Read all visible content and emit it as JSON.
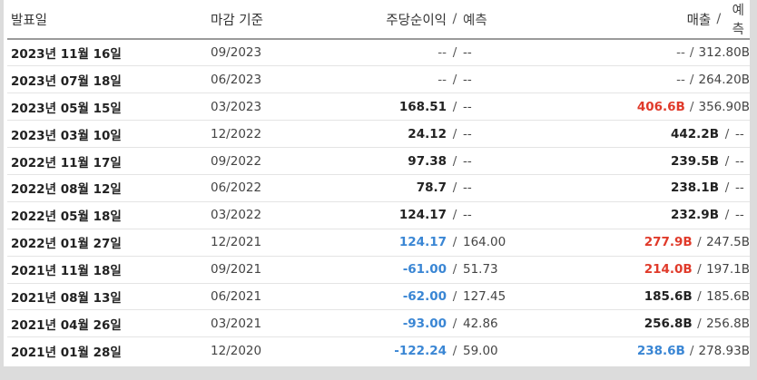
{
  "header": {
    "date": "발표일",
    "period": "마감 기준",
    "eps": "주당순이익",
    "revenue": "매출",
    "separator": "/",
    "forecast": "예측"
  },
  "colors": {
    "beat": "#3a86d4",
    "miss": "#e03a2a",
    "neutral": "#222222"
  },
  "rows": [
    {
      "date": "2023년 11월 16일",
      "period": "09/2023",
      "eps": "--",
      "eps_forecast": "--",
      "eps_status": "dash",
      "revenue": "--",
      "revenue_forecast": "312.80B",
      "revenue_status": "dash"
    },
    {
      "date": "2023년 07월 18일",
      "period": "06/2023",
      "eps": "--",
      "eps_forecast": "--",
      "eps_status": "dash",
      "revenue": "--",
      "revenue_forecast": "264.20B",
      "revenue_status": "dash"
    },
    {
      "date": "2023년 05월 15일",
      "period": "03/2023",
      "eps": "168.51",
      "eps_forecast": "--",
      "eps_status": "neutral",
      "revenue": "406.6B",
      "revenue_forecast": "356.90B",
      "revenue_status": "red"
    },
    {
      "date": "2023년 03월 10일",
      "period": "12/2022",
      "eps": "24.12",
      "eps_forecast": "--",
      "eps_status": "neutral",
      "revenue": "442.2B",
      "revenue_forecast": "--",
      "revenue_status": "neutral"
    },
    {
      "date": "2022년 11월 17일",
      "period": "09/2022",
      "eps": "97.38",
      "eps_forecast": "--",
      "eps_status": "neutral",
      "revenue": "239.5B",
      "revenue_forecast": "--",
      "revenue_status": "neutral"
    },
    {
      "date": "2022년 08월 12일",
      "period": "06/2022",
      "eps": "78.7",
      "eps_forecast": "--",
      "eps_status": "neutral",
      "revenue": "238.1B",
      "revenue_forecast": "--",
      "revenue_status": "neutral"
    },
    {
      "date": "2022년 05월 18일",
      "period": "03/2022",
      "eps": "124.17",
      "eps_forecast": "--",
      "eps_status": "neutral",
      "revenue": "232.9B",
      "revenue_forecast": "--",
      "revenue_status": "neutral"
    },
    {
      "date": "2022년 01월 27일",
      "period": "12/2021",
      "eps": "124.17",
      "eps_forecast": "164.00",
      "eps_status": "blue",
      "revenue": "277.9B",
      "revenue_forecast": "247.5B",
      "revenue_status": "red"
    },
    {
      "date": "2021년 11월 18일",
      "period": "09/2021",
      "eps": "-61.00",
      "eps_forecast": "51.73",
      "eps_status": "blue",
      "revenue": "214.0B",
      "revenue_forecast": "197.1B",
      "revenue_status": "red"
    },
    {
      "date": "2021년 08월 13일",
      "period": "06/2021",
      "eps": "-62.00",
      "eps_forecast": "127.45",
      "eps_status": "blue",
      "revenue": "185.6B",
      "revenue_forecast": "185.6B",
      "revenue_status": "neutral"
    },
    {
      "date": "2021년 04월 26일",
      "period": "03/2021",
      "eps": "-93.00",
      "eps_forecast": "42.86",
      "eps_status": "blue",
      "revenue": "256.8B",
      "revenue_forecast": "256.8B",
      "revenue_status": "neutral"
    },
    {
      "date": "2021년 01월 28일",
      "period": "12/2020",
      "eps": "-122.24",
      "eps_forecast": "59.00",
      "eps_status": "blue",
      "revenue": "238.6B",
      "revenue_forecast": "278.93B",
      "revenue_status": "blue"
    }
  ]
}
